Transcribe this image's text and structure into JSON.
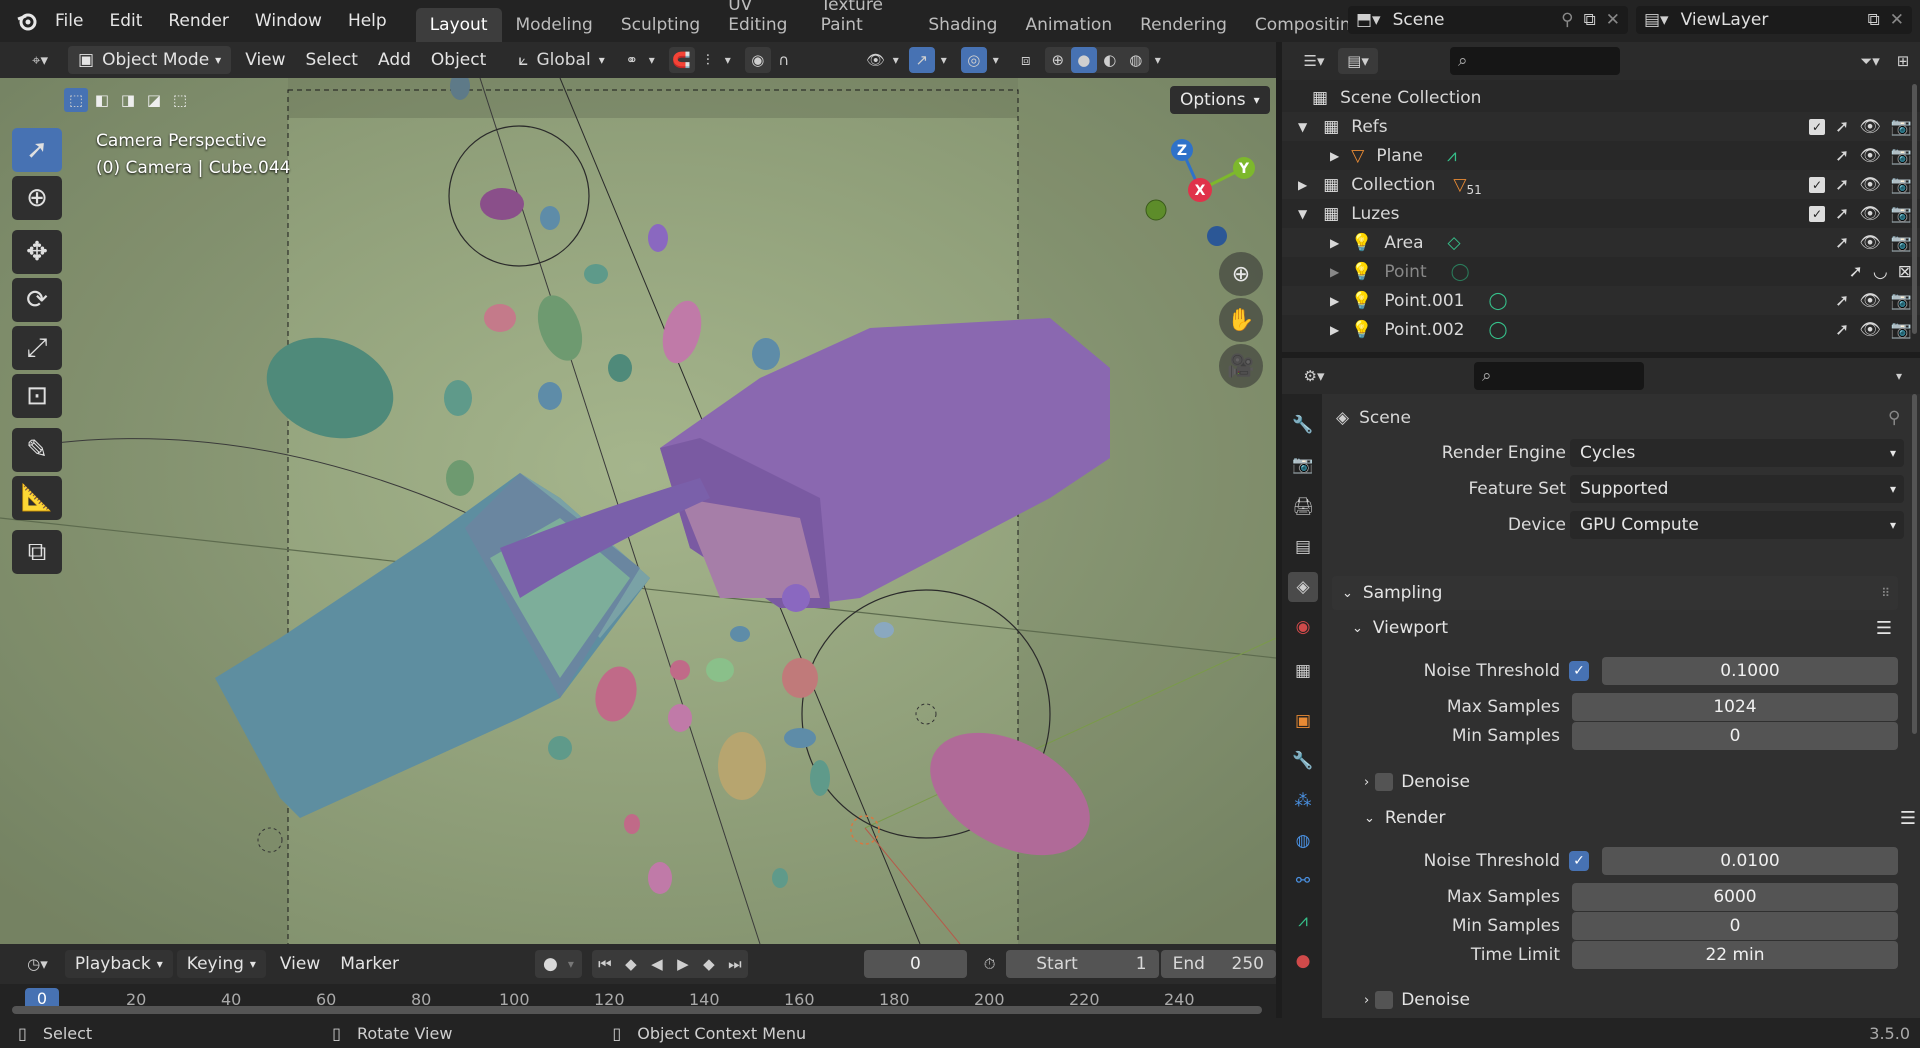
{
  "topbar": {
    "menus": [
      "File",
      "Edit",
      "Render",
      "Window",
      "Help"
    ],
    "workspaces": [
      "Layout",
      "Modeling",
      "Sculpting",
      "UV Editing",
      "Texture Paint",
      "Shading",
      "Animation",
      "Rendering",
      "Compositin"
    ],
    "active_workspace": "Layout",
    "scene_name": "Scene",
    "view_layer": "ViewLayer"
  },
  "viewport_header": {
    "mode": "Object Mode",
    "menus": [
      "View",
      "Select",
      "Add",
      "Object"
    ],
    "transform_orientation": "Global",
    "options_label": "Options"
  },
  "viewport": {
    "camera_label": "Camera Perspective",
    "object_label": "(0) Camera | Cube.044",
    "gizmo": {
      "z": "Z",
      "x": "X",
      "y": "Y"
    }
  },
  "timeline": {
    "menus": [
      "Playback",
      "Keying",
      "View",
      "Marker"
    ],
    "current_frame": "0",
    "start_label": "Start",
    "start_value": "1",
    "end_label": "End",
    "end_value": "250",
    "ruler_marks": [
      "0",
      "20",
      "40",
      "60",
      "80",
      "100",
      "120",
      "140",
      "160",
      "180",
      "200",
      "220",
      "240"
    ]
  },
  "statusbar": {
    "select": "Select",
    "rotate": "Rotate View",
    "context": "Object Context Menu",
    "version": "3.5.0"
  },
  "outliner": {
    "items": [
      {
        "label": "Scene Collection",
        "type": "collection-root",
        "icon": "scene-collection-icon"
      },
      {
        "label": "Refs",
        "type": "collection",
        "expanded": true,
        "icon": "collection-icon"
      },
      {
        "label": "Plane",
        "type": "object",
        "icon": "mesh-icon"
      },
      {
        "label": "Collection",
        "type": "collection",
        "expanded": false,
        "icon": "collection-icon",
        "badge": "51"
      },
      {
        "label": "Luzes",
        "type": "collection",
        "expanded": true,
        "icon": "collection-icon"
      },
      {
        "label": "Area",
        "type": "light",
        "icon": "light-icon"
      },
      {
        "label": "Point",
        "type": "light",
        "icon": "light-icon",
        "hidden": true
      },
      {
        "label": "Point.001",
        "type": "light",
        "icon": "light-icon"
      },
      {
        "label": "Point.002",
        "type": "light",
        "icon": "light-icon"
      }
    ]
  },
  "properties": {
    "context": "Scene",
    "render_engine_label": "Render Engine",
    "render_engine": "Cycles",
    "feature_set_label": "Feature Set",
    "feature_set": "Supported",
    "device_label": "Device",
    "device": "GPU Compute",
    "sampling": {
      "title": "Sampling",
      "viewport": {
        "title": "Viewport",
        "noise_threshold_label": "Noise Threshold",
        "noise_threshold": "0.1000",
        "max_samples_label": "Max Samples",
        "max_samples": "1024",
        "min_samples_label": "Min Samples",
        "min_samples": "0",
        "denoise_label": "Denoise"
      },
      "render": {
        "title": "Render",
        "noise_threshold_label": "Noise Threshold",
        "noise_threshold": "0.0100",
        "max_samples_label": "Max Samples",
        "max_samples": "6000",
        "min_samples_label": "Min Samples",
        "min_samples": "0",
        "time_limit_label": "Time Limit",
        "time_limit": "22 min",
        "denoise_label": "Denoise"
      }
    }
  },
  "colors": {
    "accent": "#4772b3",
    "viewport_bg": "#8b9a75",
    "gizmo_x": "#e0324a",
    "gizmo_y": "#7db82c",
    "gizmo_z": "#2f72c9",
    "purple_mesh": "#8a68b0",
    "blue_mesh": "#5e8ea0"
  }
}
